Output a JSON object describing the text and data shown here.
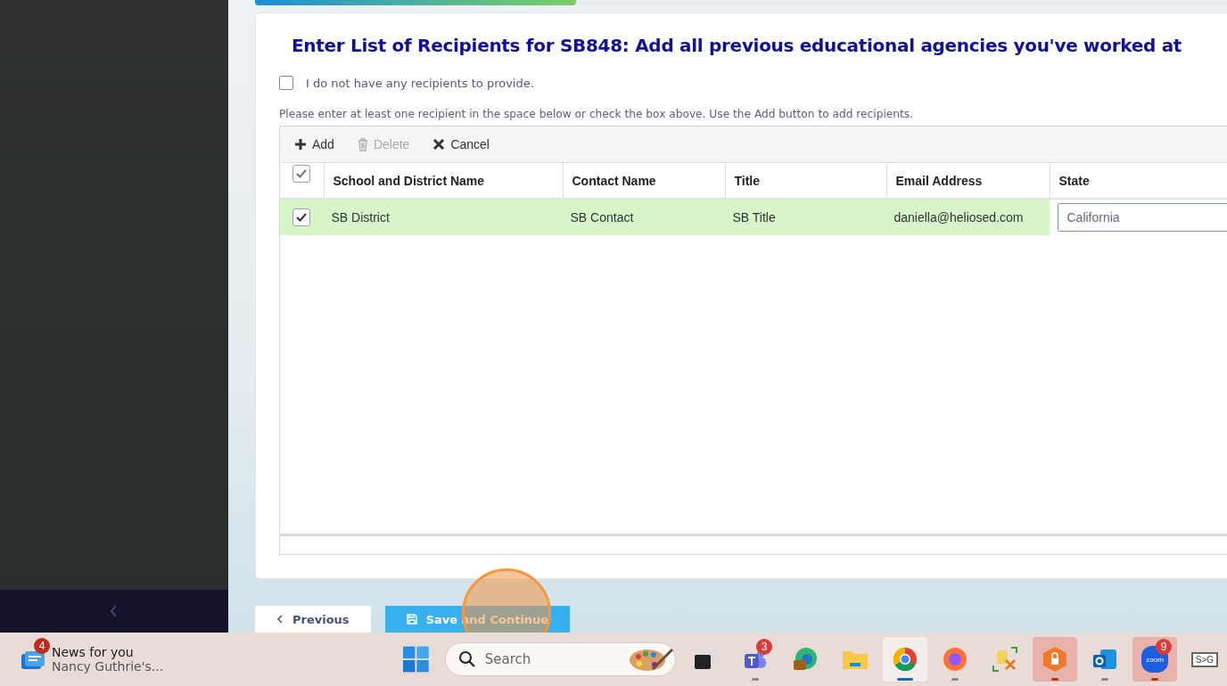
{
  "progress": {
    "level": 0.33
  },
  "heading": "Enter List of Recipients for SB848: Add all previous educational agencies you've worked at",
  "no_recipients": {
    "label": "I do not have any recipients to provide.",
    "checked": false
  },
  "instructions": "Please enter at least one recipient in the space below or check the box above. Use the Add button to add recipients.",
  "toolbar": [
    {
      "kind": "add",
      "label": "Add",
      "disabled": false
    },
    {
      "kind": "delete",
      "label": "Delete",
      "disabled": true
    },
    {
      "kind": "cancel",
      "label": "Cancel",
      "disabled": false
    }
  ],
  "table": {
    "select_all": {
      "checked": true
    },
    "columns": [
      "School and District Name",
      "Contact Name",
      "Title",
      "Email Address",
      "State"
    ],
    "rows": [
      {
        "selected": true,
        "cells": [
          "SB District",
          "SB Contact",
          "SB Title",
          "daniella@heliosed.com"
        ],
        "state": "California"
      }
    ]
  },
  "buttons": [
    {
      "kind": "previous",
      "label": "Previous"
    },
    {
      "kind": "save",
      "label": "Save and Continue"
    }
  ],
  "taskbar": {
    "news": {
      "badge": "4",
      "title": "News for you",
      "subtitle": "Nancy Guthrie's..."
    },
    "search": {
      "placeholder": "Search"
    },
    "apps": [
      {
        "kind": "taskview",
        "active": false,
        "running": false,
        "alert": false
      },
      {
        "kind": "teams",
        "active": false,
        "running": true,
        "badge": "3",
        "alert": false
      },
      {
        "kind": "edge",
        "active": false,
        "running": false,
        "alert": false
      },
      {
        "kind": "folder",
        "active": false,
        "running": false,
        "alert": false
      },
      {
        "kind": "chrome",
        "active": true,
        "running": true,
        "alert": false
      },
      {
        "kind": "firefox",
        "active": false,
        "running": true,
        "alert": false
      },
      {
        "kind": "tools",
        "active": false,
        "running": false,
        "alert": false
      },
      {
        "kind": "vpn",
        "active": false,
        "running": true,
        "alert": true
      },
      {
        "kind": "outlook",
        "active": false,
        "running": true,
        "alert": false
      },
      {
        "kind": "zoom",
        "active": false,
        "running": true,
        "badge": "9",
        "alert": true,
        "text": "zoom"
      },
      {
        "kind": "monitor",
        "active": false,
        "running": false,
        "alert": false,
        "text": "S>G"
      }
    ]
  }
}
